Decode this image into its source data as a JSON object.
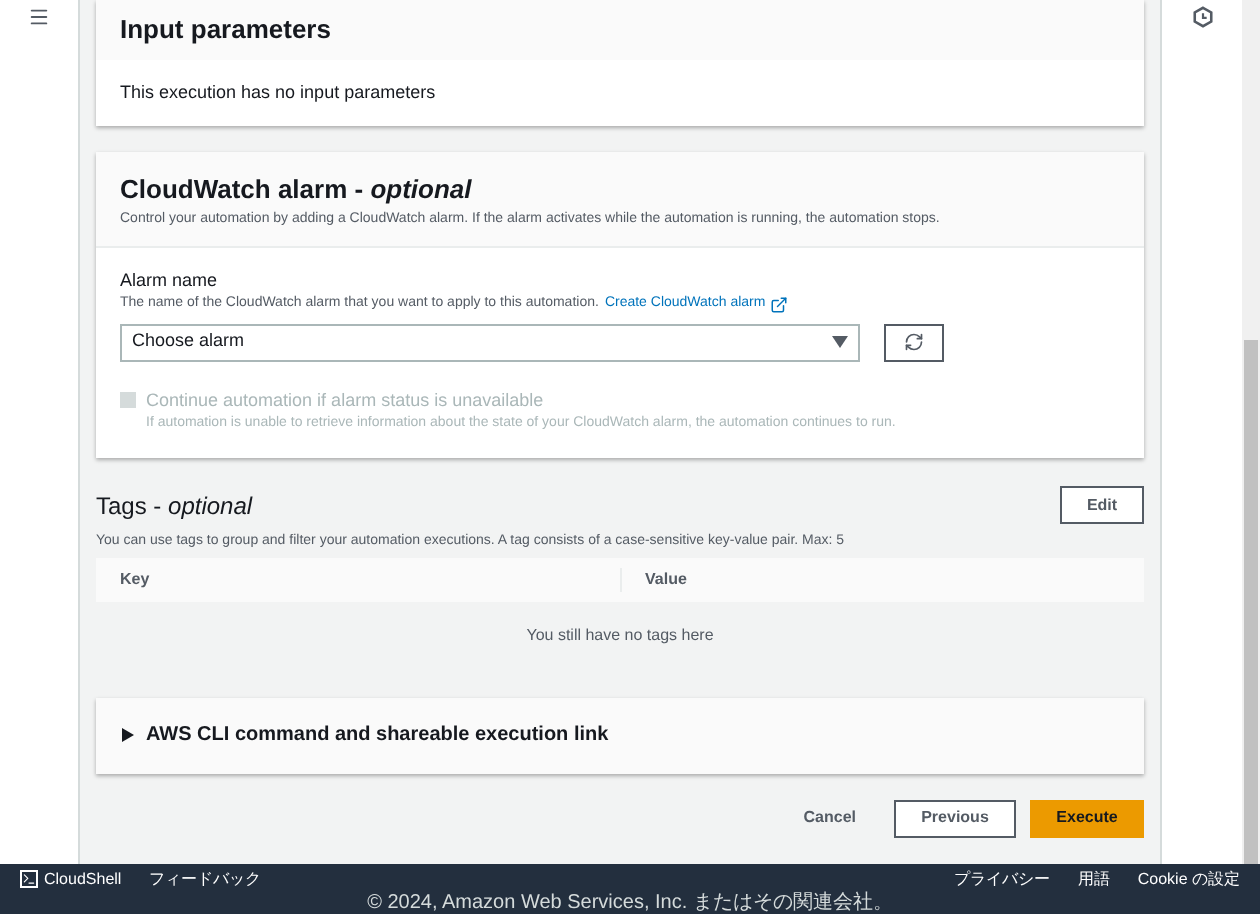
{
  "input_parameters": {
    "title": "Input parameters",
    "message": "This execution has no input parameters"
  },
  "cloudwatch_alarm": {
    "title": "CloudWatch alarm - *optional*",
    "description": "Control your automation by adding a CloudWatch alarm. If the alarm activates while the automation is running, the automation stops.",
    "alarm_name": {
      "label": "Alarm name",
      "description": "The name of the CloudWatch alarm that you want to apply to this automation.",
      "link": "Create CloudWatch alarm",
      "placeholder": "Choose alarm"
    },
    "continue_option": {
      "label": "Continue automation if alarm status is unavailable",
      "description": "If automation is unable to retrieve information about the state of your CloudWatch alarm, the automation continues to run.",
      "checked": false,
      "disabled": true
    }
  },
  "tags": {
    "title": "Tags - *optional*",
    "edit_button": "Edit",
    "description": "You can use tags to group and filter your automation executions. A tag consists of a case-sensitive key-value pair. Max: 5",
    "columns": [
      "Key",
      "Value"
    ],
    "empty_message": "You still have no tags here"
  },
  "cli_section": {
    "title": "AWS CLI command and shareable execution link",
    "expanded": false
  },
  "actions": {
    "cancel": "Cancel",
    "previous": "Previous",
    "execute": "Execute"
  },
  "footer": {
    "left": [
      "CloudShell",
      "フィードバック"
    ],
    "right": [
      "プライバシー",
      "用語",
      "Cookie の設定"
    ],
    "copyright": "© 2024, Amazon Web Services, Inc. またはその関連会社。"
  }
}
